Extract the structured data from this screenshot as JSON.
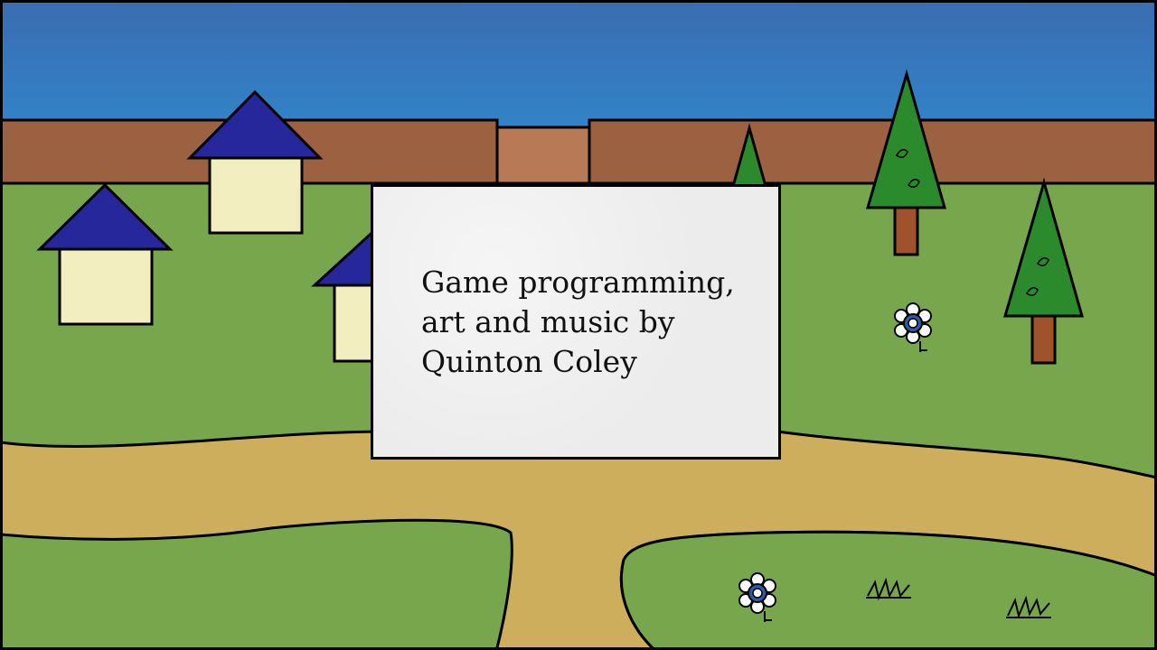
{
  "dialog": {
    "lines": [
      "Game programming,",
      "art and music by",
      "Quinton Coley"
    ]
  },
  "colors": {
    "sky_top": "#3a6db0",
    "sky_bottom": "#2f8cd3",
    "wall": "#9b6140",
    "gate": "#b87a56",
    "grass": "#77a64c",
    "path": "#cdae5c",
    "roof": "#25279a",
    "house_wall": "#f2eec0",
    "tree_foliage": "#2b8a2b",
    "trunk": "#a0522d",
    "dialog_bg": "#ececec"
  },
  "scene_objects": [
    "house",
    "house",
    "house",
    "tree",
    "tree",
    "tree",
    "flower",
    "flower",
    "grass-tuft",
    "grass-tuft"
  ]
}
